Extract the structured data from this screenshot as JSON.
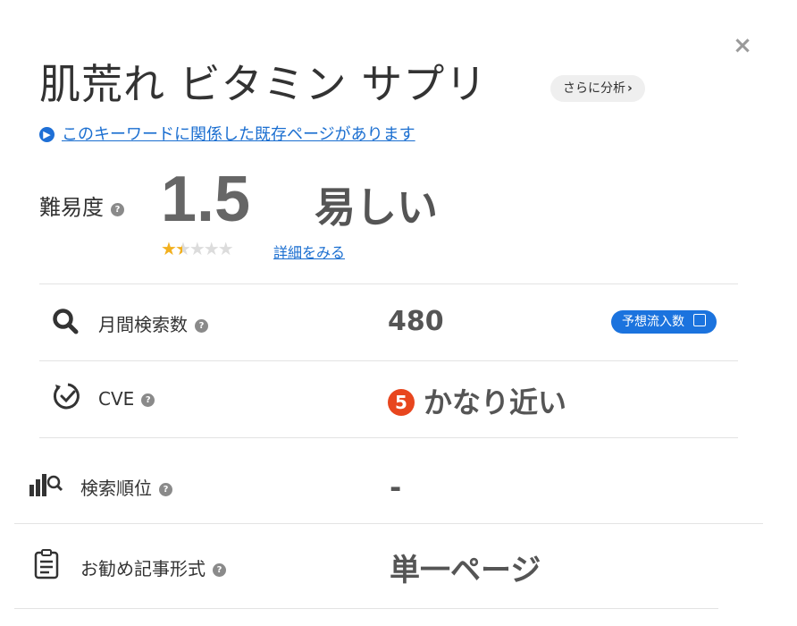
{
  "close_label": "×",
  "title": "肌荒れ ビタミン サプリ",
  "analyze_button": {
    "label": "さらに分析",
    "chevron": "›"
  },
  "existing_page_link": "このキーワードに関係した既存ページがあります",
  "difficulty": {
    "label": "難易度",
    "help": "?",
    "value": "1.5",
    "text": "易しい",
    "stars": {
      "filled": "★",
      "half": "★",
      "empty": "★★★",
      "rating": 1.5,
      "max": 5
    },
    "details_link": "詳細をみる"
  },
  "rows": {
    "monthly": {
      "icon": "search-icon",
      "label": "月間検索数",
      "help": "?",
      "value": "480",
      "badge": "予想流入数"
    },
    "cve": {
      "icon": "clock-check-icon",
      "label": "CVE",
      "help": "?",
      "number": "5",
      "text": "かなり近い",
      "number_color": "#e8461e"
    },
    "rank": {
      "icon": "rank-chart-icon",
      "label": "検索順位",
      "help": "?",
      "value": "-"
    },
    "format": {
      "icon": "document-icon",
      "label": "お勧め記事形式",
      "help": "?",
      "value": "単一ページ"
    }
  },
  "colors": {
    "link": "#1a6ed0",
    "badge": "#1b73de",
    "star": "#f2b01e",
    "value": "#555555"
  }
}
